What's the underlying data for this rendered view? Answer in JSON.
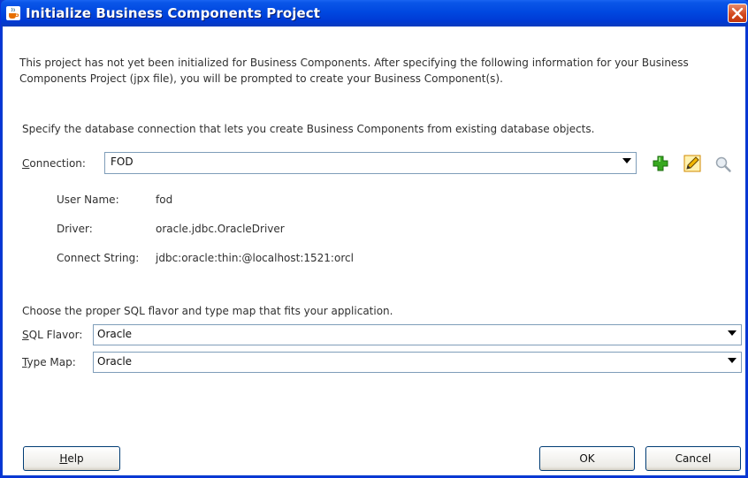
{
  "window": {
    "title": "Initialize Business Components Project"
  },
  "intro": {
    "text": "This project has not yet been initialized for Business Components.  After specifying the following information for your Business Components Project (jpx file), you will be prompted to create your Business Component(s)."
  },
  "connection_section": {
    "instruction": "Specify the database connection that lets you create Business Components from existing database objects.",
    "label_first": "C",
    "label_rest": "onnection:",
    "value": "FOD",
    "add_icon": "plus-icon",
    "edit_icon": "pencil-icon",
    "browse_icon": "magnifier-icon",
    "details": {
      "user_name_label": "User Name:",
      "user_name_value": "fod",
      "driver_label": "Driver:",
      "driver_value": "oracle.jdbc.OracleDriver",
      "connect_string_label": "Connect String:",
      "connect_string_value": "jdbc:oracle:thin:@localhost:1521:orcl"
    }
  },
  "sql_section": {
    "instruction": "Choose the proper SQL flavor and type map that fits your application.",
    "sql_flavor_label_first": "S",
    "sql_flavor_label_rest": "QL Flavor:",
    "sql_flavor_value": "Oracle",
    "type_map_label_first": "T",
    "type_map_label_rest": "ype Map:",
    "type_map_value": "Oracle"
  },
  "buttons": {
    "help_first": "H",
    "help_rest": "elp",
    "ok": "OK",
    "cancel": "Cancel"
  },
  "colors": {
    "titlebar": "#0048e0",
    "close_button": "#d44a1f",
    "field_border": "#7f9db9",
    "add_icon": "#2e9a1c",
    "edit_icon": "#f0b400"
  }
}
